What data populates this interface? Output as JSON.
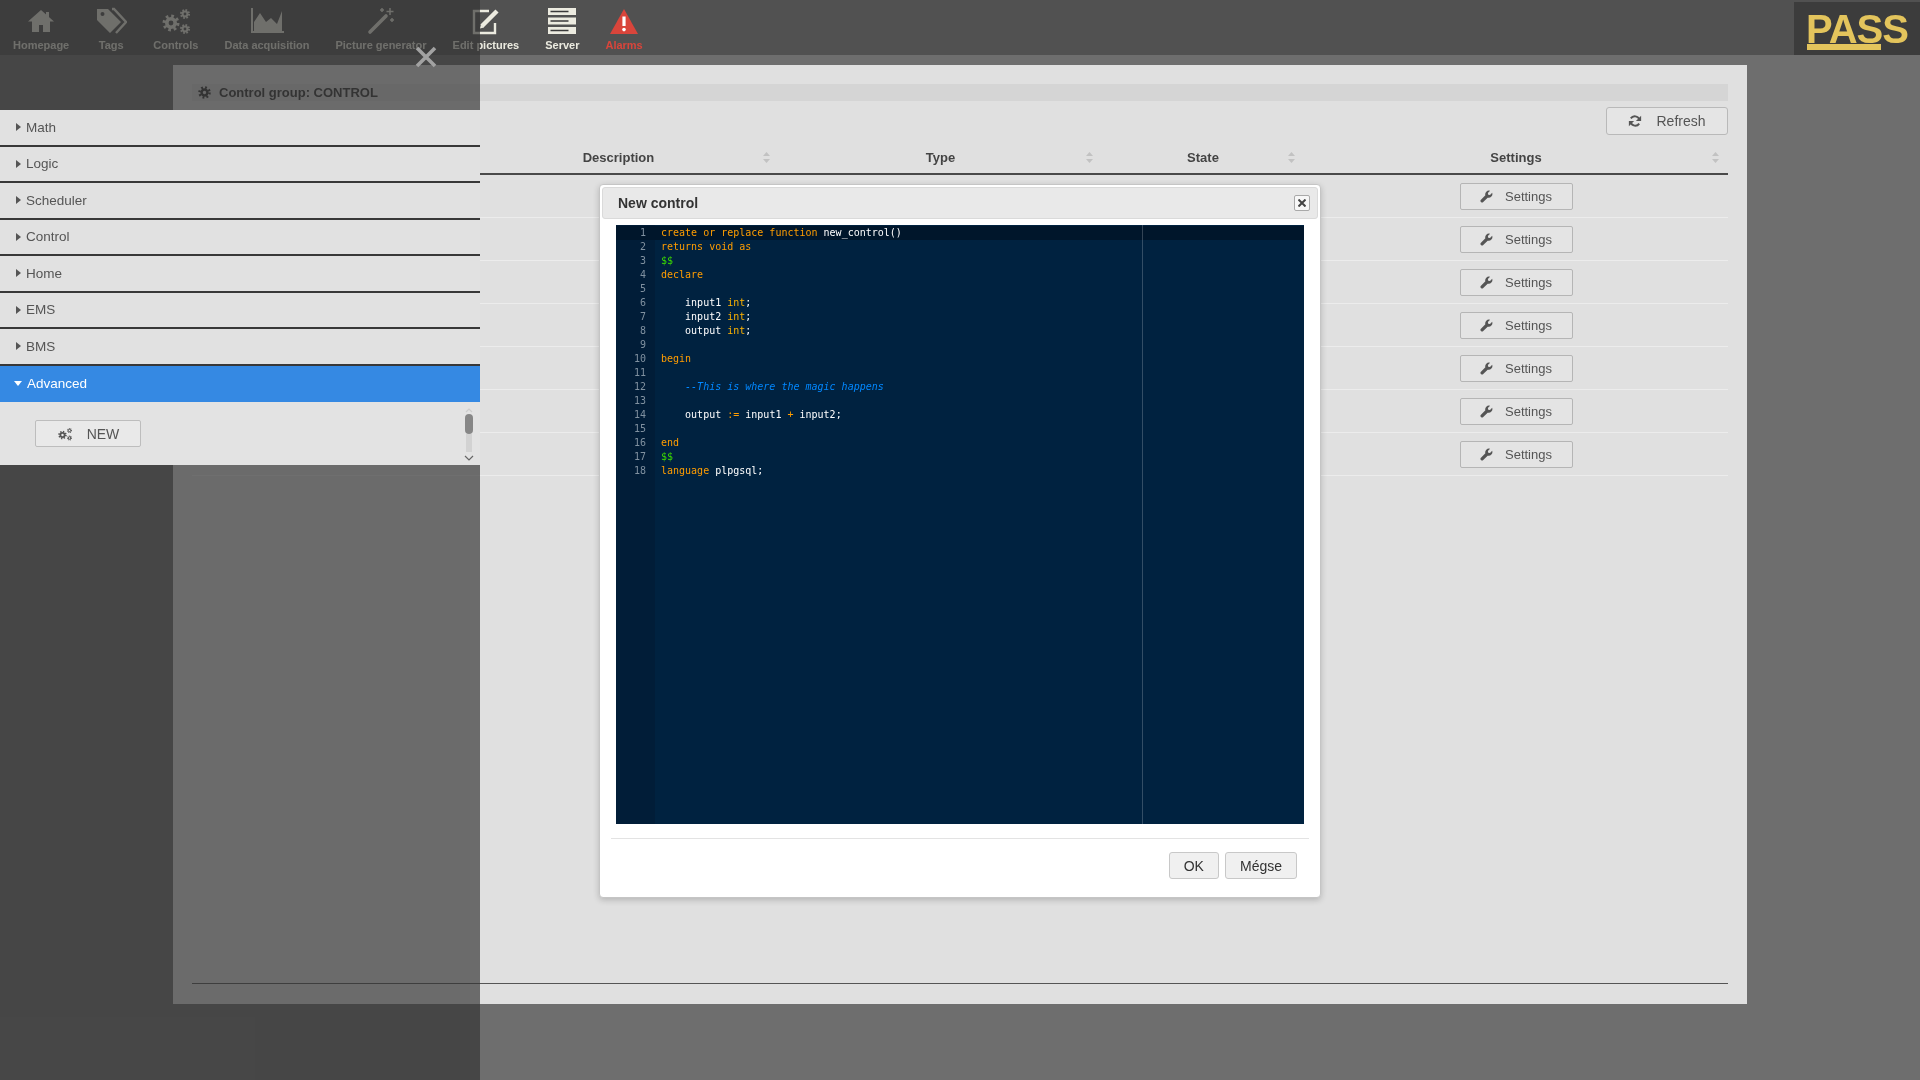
{
  "toolbar": {
    "items": [
      {
        "label": "Homepage",
        "kind": "home"
      },
      {
        "label": "Tags",
        "kind": "tag"
      },
      {
        "label": "Controls",
        "kind": "gears"
      },
      {
        "label": "Data acquisition",
        "kind": "chart"
      },
      {
        "label": "Picture generator",
        "kind": "wand"
      },
      {
        "label": "Edit pictures",
        "kind": "edit"
      },
      {
        "label": "Server",
        "kind": "server"
      },
      {
        "label": "Alarms",
        "kind": "alarm"
      }
    ],
    "logo": "PASS"
  },
  "side_menu": {
    "groups": [
      {
        "label": "Math",
        "expanded": false
      },
      {
        "label": "Logic",
        "expanded": false
      },
      {
        "label": "Scheduler",
        "expanded": false
      },
      {
        "label": "Control",
        "expanded": false
      },
      {
        "label": "Home",
        "expanded": false
      },
      {
        "label": "EMS",
        "expanded": false
      },
      {
        "label": "BMS",
        "expanded": false
      },
      {
        "label": "Advanced",
        "expanded": true,
        "button": "NEW"
      }
    ]
  },
  "panel": {
    "title": "Control group: CONTROL",
    "refresh_button": "Refresh"
  },
  "table": {
    "columns": [
      "Description",
      "Type",
      "State",
      "Settings"
    ],
    "rows": [
      {
        "settings": "Settings"
      },
      {
        "settings": "Settings"
      },
      {
        "settings": "Settings"
      },
      {
        "settings": "Settings"
      },
      {
        "settings": "Settings"
      },
      {
        "settings": "Settings"
      },
      {
        "settings": "Settings"
      }
    ]
  },
  "dialog": {
    "title": "New control",
    "editor": {
      "lines": [
        {
          "number": "1",
          "active": true,
          "tokens": [
            {
              "kind": "keyword",
              "text": "create or replace function"
            },
            {
              "kind": "plain",
              "text": " new_control()"
            }
          ]
        },
        {
          "number": "2",
          "active": false,
          "tokens": [
            {
              "kind": "keyword",
              "text": "returns void as"
            }
          ]
        },
        {
          "number": "3",
          "active": false,
          "tokens": [
            {
              "kind": "string",
              "text": "$$"
            }
          ]
        },
        {
          "number": "4",
          "active": false,
          "tokens": [
            {
              "kind": "keyword",
              "text": "declare"
            }
          ]
        },
        {
          "number": "5",
          "active": false
        },
        {
          "number": "6",
          "active": false,
          "tokens": [
            {
              "kind": "plain",
              "text": "    input1 "
            },
            {
              "kind": "type",
              "text": "int"
            },
            {
              "kind": "plain",
              "text": ";"
            }
          ]
        },
        {
          "number": "7",
          "active": false,
          "tokens": [
            {
              "kind": "plain",
              "text": "    input2 "
            },
            {
              "kind": "type",
              "text": "int"
            },
            {
              "kind": "plain",
              "text": ";"
            }
          ]
        },
        {
          "number": "8",
          "active": false,
          "tokens": [
            {
              "kind": "plain",
              "text": "    output "
            },
            {
              "kind": "type",
              "text": "int"
            },
            {
              "kind": "plain",
              "text": ";"
            }
          ]
        },
        {
          "number": "9",
          "active": false
        },
        {
          "number": "10",
          "active": false,
          "tokens": [
            {
              "kind": "keyword",
              "text": "begin"
            }
          ]
        },
        {
          "number": "11",
          "active": false
        },
        {
          "number": "12",
          "active": false,
          "tokens": [
            {
              "kind": "comment",
              "text": "    --This is where the magic happens"
            }
          ]
        },
        {
          "number": "13",
          "active": false
        },
        {
          "number": "14",
          "active": false,
          "tokens": [
            {
              "kind": "plain",
              "text": "    output "
            },
            {
              "kind": "operator",
              "text": ":="
            },
            {
              "kind": "plain",
              "text": " input1 "
            },
            {
              "kind": "operator",
              "text": "+"
            },
            {
              "kind": "plain",
              "text": " input2;"
            }
          ]
        },
        {
          "number": "15",
          "active": false
        },
        {
          "number": "16",
          "active": false,
          "tokens": [
            {
              "kind": "keyword",
              "text": "end"
            }
          ]
        },
        {
          "number": "17",
          "active": false,
          "tokens": [
            {
              "kind": "string",
              "text": "$$"
            }
          ]
        },
        {
          "number": "18",
          "active": false,
          "tokens": [
            {
              "kind": "keyword",
              "text": "language"
            },
            {
              "kind": "plain",
              "text": " plpgsql;"
            }
          ]
        }
      ]
    },
    "buttons": [
      "OK",
      "Mégse"
    ]
  }
}
